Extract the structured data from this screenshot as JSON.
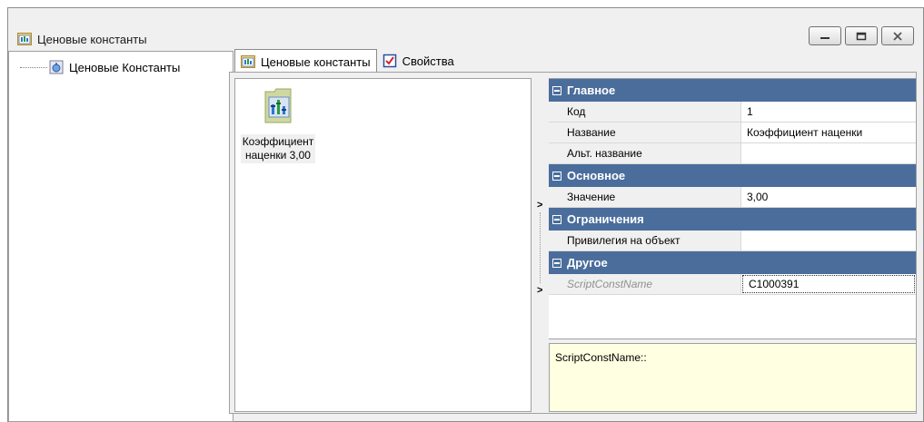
{
  "window": {
    "title": "Ценовые константы"
  },
  "tree": {
    "items": [
      {
        "label": "Ценовые Константы"
      }
    ]
  },
  "tabs": [
    {
      "label": "Ценовые константы",
      "active": true
    },
    {
      "label": "Свойства",
      "active": false
    }
  ],
  "icon_panel": {
    "item": {
      "label_line1": "Коэффициент",
      "label_line2": "наценки 3,00"
    }
  },
  "properties": {
    "categories": [
      {
        "label": "Главное",
        "rows": [
          {
            "name": "Код",
            "value": "1"
          },
          {
            "name": "Название",
            "value": "Коэффициент наценки"
          },
          {
            "name": "Альт. название",
            "value": ""
          }
        ]
      },
      {
        "label": "Основное",
        "rows": [
          {
            "name": "Значение",
            "value": "3,00"
          }
        ]
      },
      {
        "label": "Ограничения",
        "rows": [
          {
            "name": "Привилегия на объект",
            "value": ""
          }
        ]
      },
      {
        "label": "Другое",
        "rows": [
          {
            "name": "ScriptConstName",
            "value": "C1000391"
          }
        ]
      }
    ]
  },
  "description": {
    "text": "ScriptConstName::"
  },
  "colors": {
    "category_header": "#4a6d9c",
    "description_bg": "#ffffe1"
  }
}
